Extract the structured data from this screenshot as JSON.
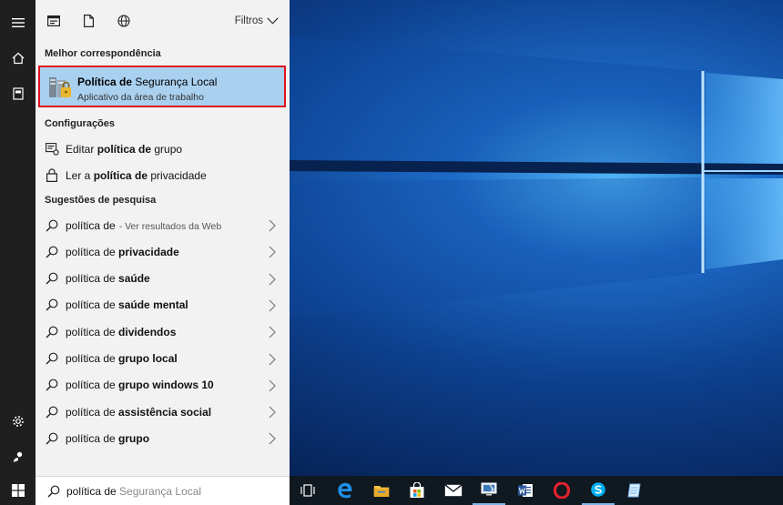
{
  "toolbar": {
    "filters_label": "Filtros"
  },
  "sections": {
    "best_match": "Melhor correspondência",
    "settings": "Configurações",
    "suggestions": "Sugestões de pesquisa"
  },
  "best_match": {
    "title_bold": "Política de",
    "title_rest": " Segurança Local",
    "subtitle": "Aplicativo da área de trabalho"
  },
  "settings": [
    {
      "prefix": "Editar ",
      "bold": "política de",
      "suffix": " grupo",
      "icon": "settings-policy-icon"
    },
    {
      "prefix": "Ler a ",
      "bold": "política de",
      "suffix": " privacidade",
      "icon": "lock-icon"
    }
  ],
  "suggestions": [
    {
      "base": "política de",
      "bold": "",
      "hint": "- Ver resultados da Web"
    },
    {
      "base": "política de ",
      "bold": "privacidade",
      "hint": ""
    },
    {
      "base": "política de ",
      "bold": "saúde",
      "hint": ""
    },
    {
      "base": "política de ",
      "bold": "saúde mental",
      "hint": ""
    },
    {
      "base": "política de ",
      "bold": "dividendos",
      "hint": ""
    },
    {
      "base": "política de ",
      "bold": "grupo local",
      "hint": ""
    },
    {
      "base": "política de ",
      "bold": "grupo windows 10",
      "hint": ""
    },
    {
      "base": "política de ",
      "bold": "assistência social",
      "hint": ""
    },
    {
      "base": "política de ",
      "bold": "grupo",
      "hint": ""
    }
  ],
  "search": {
    "typed": "política de",
    "autocomplete": " Segurança Local"
  },
  "taskbar": {
    "apps": [
      "task-view-icon",
      "edge-icon",
      "file-explorer-icon",
      "store-icon",
      "mail-icon",
      "system-tool-icon",
      "word-icon",
      "opera-icon",
      "skype-icon",
      "notes-icon"
    ]
  },
  "colors": {
    "highlight": "#aad0ef",
    "highlight_border": "#e0101e",
    "panel": "#f2f2f2",
    "rail": "#1f1f1f"
  }
}
